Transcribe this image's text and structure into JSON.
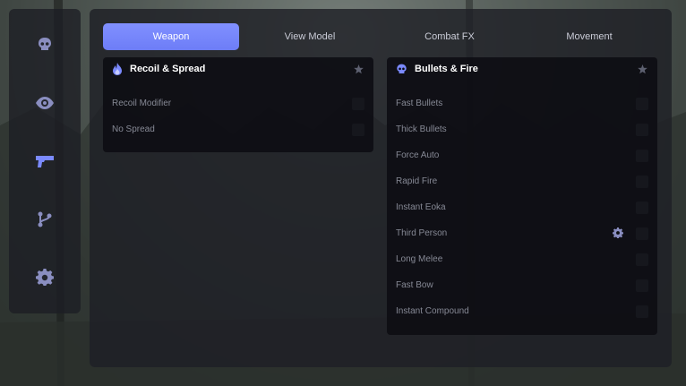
{
  "sidebar": {
    "items": [
      {
        "icon": "skull-icon"
      },
      {
        "icon": "eye-icon"
      },
      {
        "icon": "gun-icon"
      },
      {
        "icon": "branch-icon"
      },
      {
        "icon": "gear-icon"
      }
    ]
  },
  "tabs": [
    {
      "label": "Weapon",
      "active": true
    },
    {
      "label": "View Model",
      "active": false
    },
    {
      "label": "Combat FX",
      "active": false
    },
    {
      "label": "Movement",
      "active": false
    }
  ],
  "panels": {
    "recoil": {
      "title": "Recoil & Spread",
      "icon": "flame-icon",
      "rows": [
        {
          "label": "Recoil Modifier"
        },
        {
          "label": "No Spread"
        }
      ]
    },
    "bullets": {
      "title": "Bullets & Fire",
      "icon": "skull-icon",
      "rows": [
        {
          "label": "Fast Bullets"
        },
        {
          "label": "Thick Bullets"
        },
        {
          "label": "Force Auto"
        },
        {
          "label": "Rapid Fire"
        },
        {
          "label": "Instant Eoka"
        },
        {
          "label": "Third Person",
          "has_settings": true
        },
        {
          "label": "Long Melee"
        },
        {
          "label": "Fast Bow"
        },
        {
          "label": "Instant Compound"
        }
      ]
    }
  },
  "colors": {
    "accent": "#7b8aff",
    "panel_bg": "#0c0d12",
    "row_text": "#868995",
    "checkbox": "#16171d"
  }
}
